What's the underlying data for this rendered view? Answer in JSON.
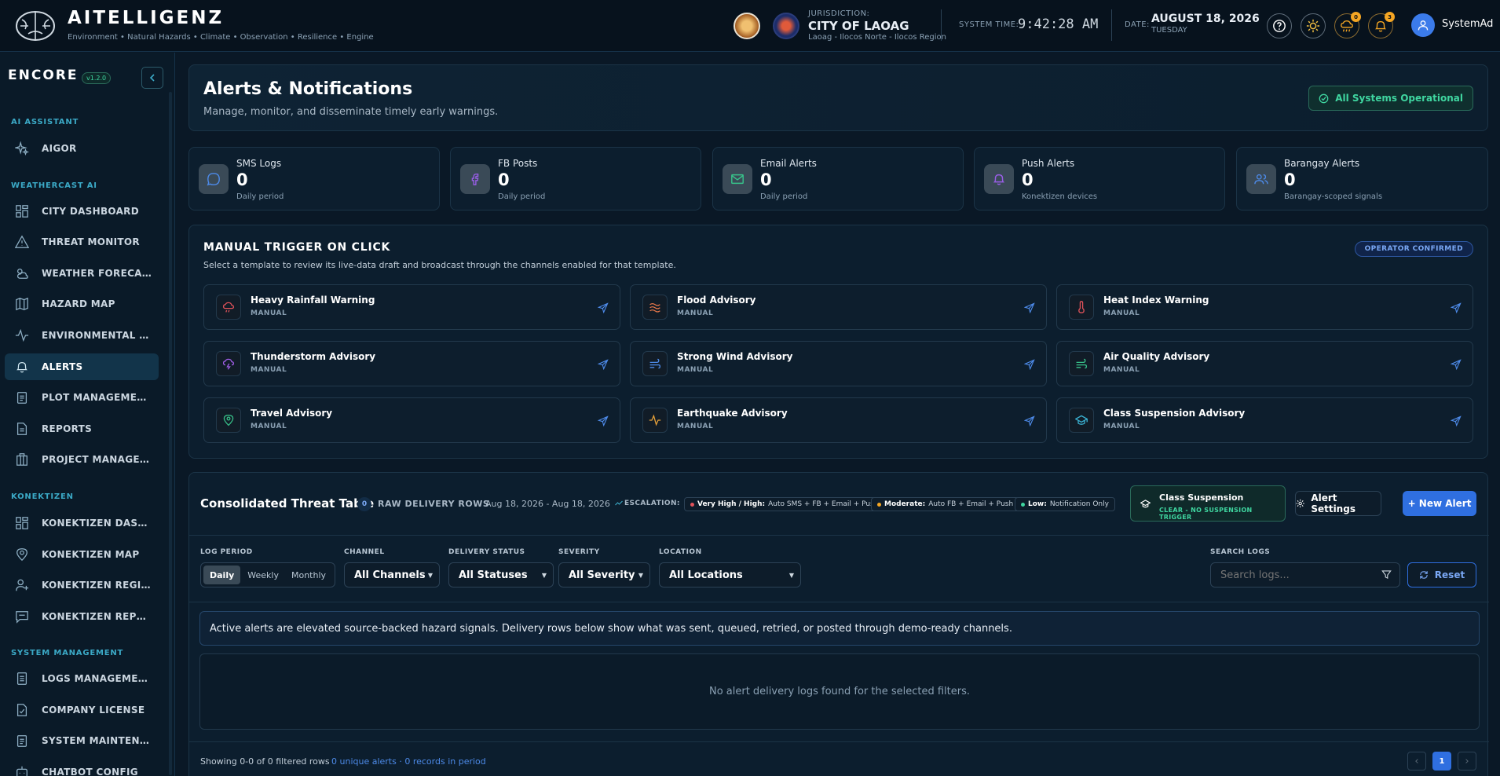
{
  "header": {
    "brand": "AITELLIGENZ",
    "tagline": "Environment • Natural Hazards • Climate • Observation • Resilience • Engine",
    "jurisdiction_label": "JURISDICTION:",
    "city": "CITY OF LAOAG",
    "region": "Laoag - Ilocos Norte - Ilocos Region",
    "system_time_label": "SYSTEM TIME:",
    "system_time": "9:42:28 AM",
    "date_label": "DATE:",
    "date": "AUGUST 18, 2026",
    "weekday": "TUESDAY",
    "weather_badge": "0",
    "notif_badge": "3",
    "user": "SystemAd"
  },
  "sidebar": {
    "logo": "ENCORE",
    "version": "v1.2.0",
    "sections": {
      "ai": "AI ASSISTANT",
      "weathercast": "WEATHERCAST AI",
      "konektizen": "KONEKTIZEN",
      "system": "SYSTEM MANAGEMENT"
    },
    "items": {
      "aigor": "AIGOR",
      "city_dashboard": "CITY DASHBOARD",
      "threat_monitor": "THREAT MONITOR",
      "weather_forecast": "WEATHER FORECAST",
      "hazard_map": "HAZARD MAP",
      "environmental": "ENVIRONMENTAL INTE...",
      "alerts": "ALERTS",
      "plot_management": "PLOT MANAGEMENT",
      "reports": "REPORTS",
      "project_management": "PROJECT MANAGEMENT",
      "k_dashboard": "KONEKTIZEN DASHBO...",
      "k_map": "KONEKTIZEN MAP",
      "k_registry": "KONEKTIZEN REGISTR...",
      "k_reports": "KONEKTIZEN REPORTS",
      "logs_management": "LOGS MANAGEMENT",
      "company_license": "COMPANY LICENSE",
      "system_maintenance": "SYSTEM MAINTENANCE",
      "chatbot_config": "CHATBOT CONFIG"
    }
  },
  "page": {
    "title": "Alerts & Notifications",
    "subtitle": "Manage, monitor, and disseminate timely early warnings.",
    "status": "All Systems Operational"
  },
  "stats": [
    {
      "label": "SMS Logs",
      "value": "0",
      "sub": "Daily period"
    },
    {
      "label": "FB Posts",
      "value": "0",
      "sub": "Daily period"
    },
    {
      "label": "Email Alerts",
      "value": "0",
      "sub": "Daily period"
    },
    {
      "label": "Push Alerts",
      "value": "0",
      "sub": "Konektizen devices"
    },
    {
      "label": "Barangay Alerts",
      "value": "0",
      "sub": "Barangay-scoped signals"
    }
  ],
  "trigger": {
    "title": "MANUAL TRIGGER ON CLICK",
    "desc": "Select a template to review its live-data draft and broadcast through the channels enabled for that template.",
    "badge": "OPERATOR CONFIRMED",
    "templates": [
      {
        "name": "Heavy Rainfall Warning",
        "mode": "MANUAL",
        "color": "#e0525a"
      },
      {
        "name": "Flood Advisory",
        "mode": "MANUAL",
        "color": "#e8774a"
      },
      {
        "name": "Heat Index Warning",
        "mode": "MANUAL",
        "color": "#e0525a"
      },
      {
        "name": "Thunderstorm Advisory",
        "mode": "MANUAL",
        "color": "#a25ee8"
      },
      {
        "name": "Strong Wind Advisory",
        "mode": "MANUAL",
        "color": "#4d8ae8"
      },
      {
        "name": "Air Quality Advisory",
        "mode": "MANUAL",
        "color": "#38c28a"
      },
      {
        "name": "Travel Advisory",
        "mode": "MANUAL",
        "color": "#38c28a"
      },
      {
        "name": "Earthquake Advisory",
        "mode": "MANUAL",
        "color": "#e8a23a"
      },
      {
        "name": "Class Suspension Advisory",
        "mode": "MANUAL",
        "color": "#3bb5d6"
      }
    ]
  },
  "table": {
    "title": "Consolidated Threat Table",
    "count": "0",
    "raw": "RAW DELIVERY ROWS",
    "range": "Aug 18, 2026 - Aug 18, 2026",
    "escalation": "ESCALATION:",
    "esc_high_k": "Very High / High:",
    "esc_high_v": "Auto SMS + FB + Email + Push",
    "esc_mod_k": "Moderate:",
    "esc_mod_v": "Auto FB + Email + Push",
    "esc_low_k": "Low:",
    "esc_low_v": "Notification Only",
    "class_title": "Class Suspension",
    "class_sub": "CLEAR - NO SUSPENSION TRIGGER",
    "settings": "Alert Settings",
    "new_alert": "+ New Alert",
    "filters": {
      "period_label": "LOG PERIOD",
      "period": [
        "Daily",
        "Weekly",
        "Monthly"
      ],
      "channel_label": "CHANNEL",
      "channel": "All Channels",
      "status_label": "DELIVERY STATUS",
      "status": "All Statuses",
      "severity_label": "SEVERITY",
      "severity": "All Severity",
      "location_label": "LOCATION",
      "location": "All Locations",
      "search_label": "SEARCH LOGS",
      "search_placeholder": "Search logs...",
      "reset": "Reset"
    },
    "info": "Active alerts are elevated source-backed hazard signals. Delivery rows below show what was sent, queued, retried, or posted through demo-ready channels.",
    "empty": "No alert delivery logs found for the selected filters.",
    "showing": "Showing 0-0 of 0 filtered rows",
    "summary": "0 unique alerts · 0 records in period",
    "page": "1",
    "prev": "‹",
    "next": "›"
  },
  "colors": {
    "accent": "#2f6fe0",
    "teal": "#3ba9c6",
    "ok": "#3fd6a0",
    "bg": "#0a1826"
  }
}
